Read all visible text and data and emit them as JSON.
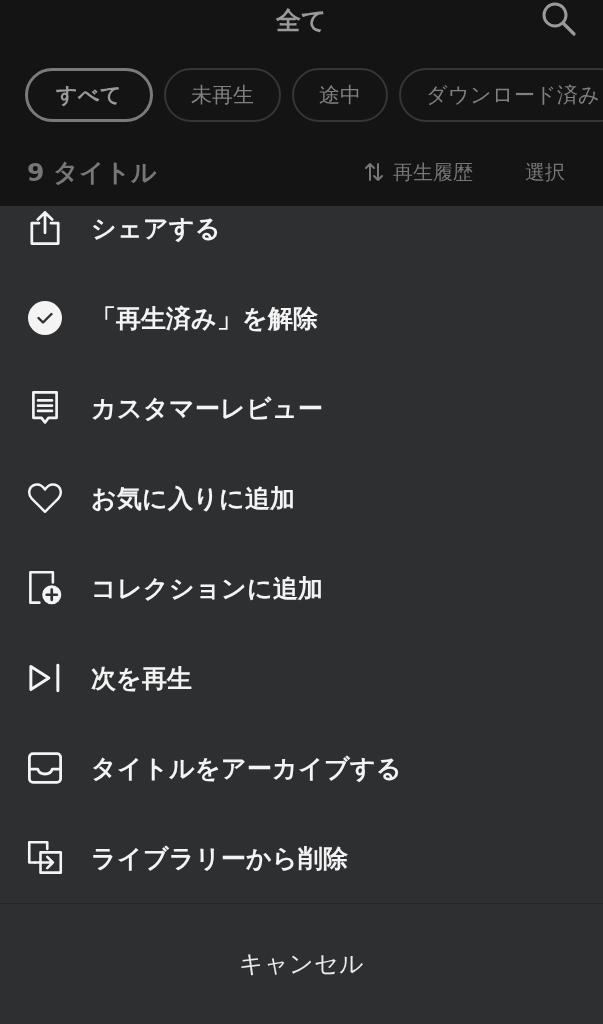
{
  "header": {
    "title": "全て"
  },
  "filters": [
    {
      "label": "すべて",
      "selected": true
    },
    {
      "label": "未再生",
      "selected": false
    },
    {
      "label": "途中",
      "selected": false
    },
    {
      "label": "ダウンロード済み",
      "selected": false
    }
  ],
  "list_bar": {
    "count": "9 タイトル",
    "sort": "再生履歴",
    "select": "選択"
  },
  "menu": {
    "items": [
      {
        "kind": "share",
        "label": "シェアする"
      },
      {
        "kind": "played",
        "label": "「再生済み」を解除"
      },
      {
        "kind": "review",
        "label": "カスタマーレビュー"
      },
      {
        "kind": "favorite",
        "label": "お気に入りに追加"
      },
      {
        "kind": "collection",
        "label": "コレクションに追加"
      },
      {
        "kind": "play_next",
        "label": "次を再生"
      },
      {
        "kind": "archive",
        "label": "タイトルをアーカイブする"
      },
      {
        "kind": "remove",
        "label": "ライブラリーから削除"
      }
    ],
    "cancel": "キャンセル"
  }
}
